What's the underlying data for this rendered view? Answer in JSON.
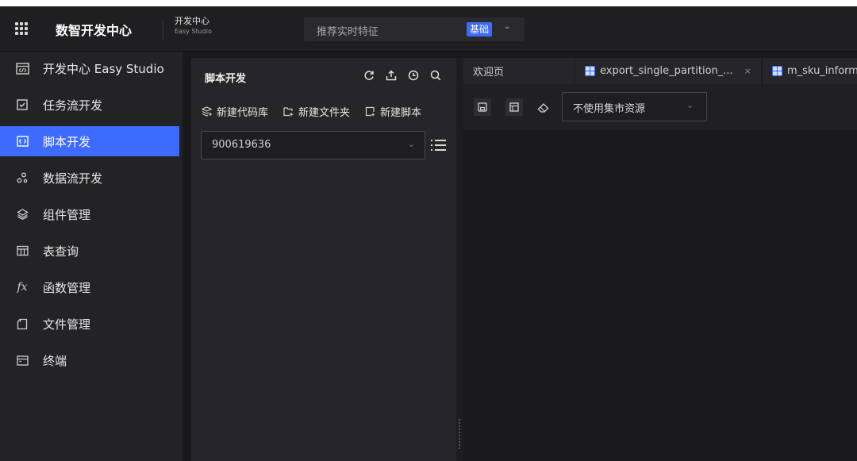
{
  "topbar": {
    "brand": "数智开发中心",
    "subtitle": "开发中心",
    "subtitle_en": "Easy Studio",
    "search_placeholder": "推荐实时特征",
    "search_tag": "基础",
    "menu_icon": "grid-icon",
    "dropdown_icon": "chevron-down-icon"
  },
  "nav": {
    "items": [
      {
        "label": "开发中心 Easy Studio",
        "icon": "studio-icon"
      },
      {
        "label": "任务流开发",
        "icon": "checkbox-icon"
      },
      {
        "label": "脚本开发",
        "icon": "code-icon"
      },
      {
        "label": "数据流开发",
        "icon": "dataflow-icon"
      },
      {
        "label": "组件管理",
        "icon": "layers-icon"
      },
      {
        "label": "表查询",
        "icon": "table-icon"
      },
      {
        "label": "函数管理",
        "icon": "function-icon"
      },
      {
        "label": "文件管理",
        "icon": "folder-icon"
      },
      {
        "label": "终端",
        "icon": "terminal-icon"
      }
    ],
    "active_index": 2
  },
  "script_panel": {
    "title": "脚本开发",
    "tools": [
      "refresh-icon",
      "upload-icon",
      "history-icon",
      "search-icon"
    ],
    "actions": [
      {
        "label": "新建代码库",
        "icon": "new-repo-icon"
      },
      {
        "label": "新建文件夹",
        "icon": "new-folder-icon"
      },
      {
        "label": "新建脚本",
        "icon": "new-script-icon"
      }
    ],
    "repo_value": "900619636",
    "list_icon": "list-icon"
  },
  "editor": {
    "tabs": [
      {
        "label": "欢迎页"
      },
      {
        "label": "export_single_partition_...",
        "closable": true
      },
      {
        "label": "m_sku_inform"
      }
    ],
    "toolbar": [
      "save-icon",
      "layout-icon",
      "eraser-icon"
    ],
    "resource_value": "不使用集市资源"
  },
  "colors": {
    "accent": "#3d6bff",
    "background": "#19191b",
    "panel": "#26262a"
  }
}
